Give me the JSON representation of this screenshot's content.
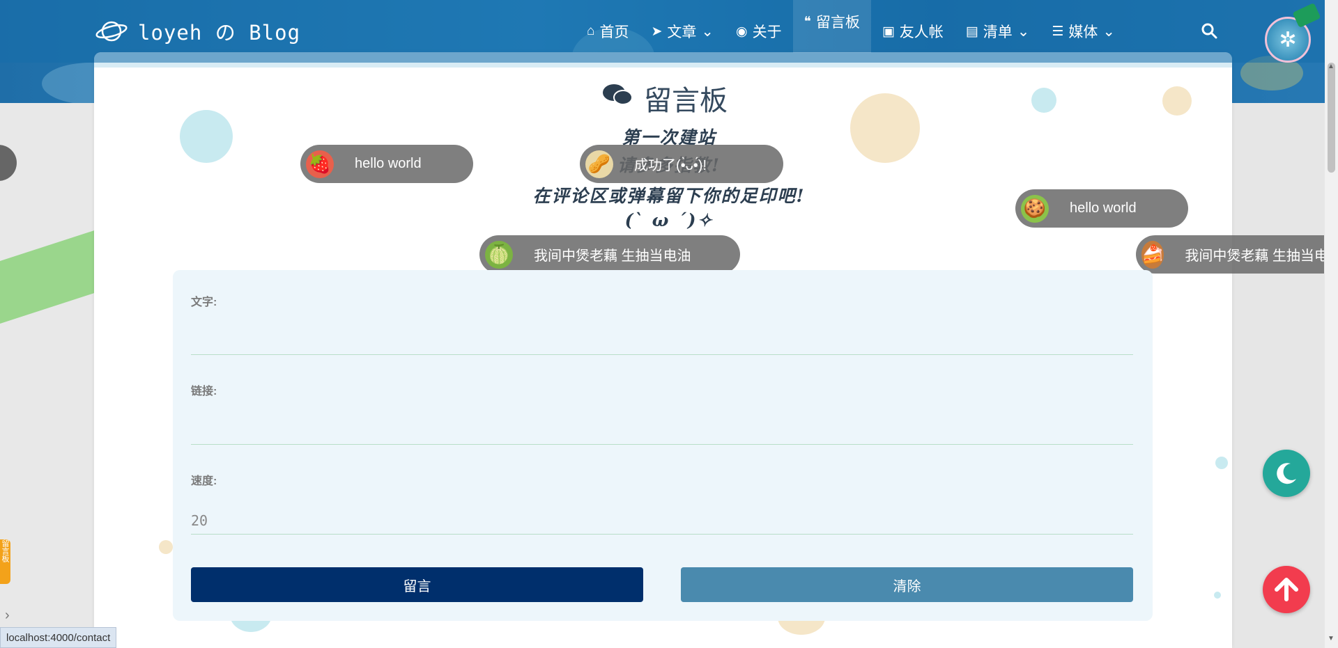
{
  "brand": {
    "name": "loyeh の Blog"
  },
  "nav": {
    "items": [
      {
        "label": "首页",
        "icon": "home-icon",
        "glyph": "⌂",
        "dropdown": false
      },
      {
        "label": "文章",
        "icon": "paper-plane-icon",
        "glyph": "➤",
        "dropdown": true
      },
      {
        "label": "关于",
        "icon": "user-circle-icon",
        "glyph": "◉",
        "dropdown": false
      },
      {
        "label": "留言板",
        "icon": "comments-icon",
        "glyph": "❝",
        "dropdown": false,
        "active": true
      },
      {
        "label": "友人帐",
        "icon": "address-book-icon",
        "glyph": "▣",
        "dropdown": false
      },
      {
        "label": "清单",
        "icon": "id-card-icon",
        "glyph": "▤",
        "dropdown": true
      },
      {
        "label": "媒体",
        "icon": "list-icon",
        "glyph": "☰",
        "dropdown": true
      }
    ],
    "search_icon": "search-icon"
  },
  "page": {
    "title": "留言板",
    "intro": [
      "第一次建站",
      "请多多指教!",
      "在评论区或弹幕留下你的足印吧!",
      "(ˋ ω ˊ)✧"
    ]
  },
  "barrage": [
    {
      "text": "hello world",
      "emoji": "strawberry-icon",
      "glyph": "🍓",
      "color": "#e8604c"
    },
    {
      "text": "成功了(•̀ᴗ•́)!",
      "emoji": "pistachio-icon",
      "glyph": "🥜",
      "color": "#e9d8a6"
    },
    {
      "text": "hello world",
      "emoji": "macaron-icon",
      "glyph": "🍪",
      "color": "#8bc34a"
    },
    {
      "text": "我间中煲老藕 生抽当电油",
      "emoji": "melon-icon",
      "glyph": "🍈",
      "color": "#7cb342"
    },
    {
      "text": "我间中煲老藕 生抽当电油",
      "emoji": "cake-icon",
      "glyph": "🍰",
      "color": "#c77b3b"
    }
  ],
  "form": {
    "text_label": "文字:",
    "text_value": "",
    "link_label": "链接:",
    "link_value": "",
    "speed_label": "速度:",
    "speed_value": "20",
    "submit_label": "留言",
    "clear_label": "清除"
  },
  "status_bar": {
    "url": "localhost:4000/contact"
  },
  "left_widget": {
    "label": "留言板"
  },
  "colors": {
    "navbar": "#1f6ea8",
    "submit_button": "#002f6c",
    "clear_button": "#4a8aae",
    "moon_button": "#24a89a",
    "top_button": "#f23c4e"
  }
}
